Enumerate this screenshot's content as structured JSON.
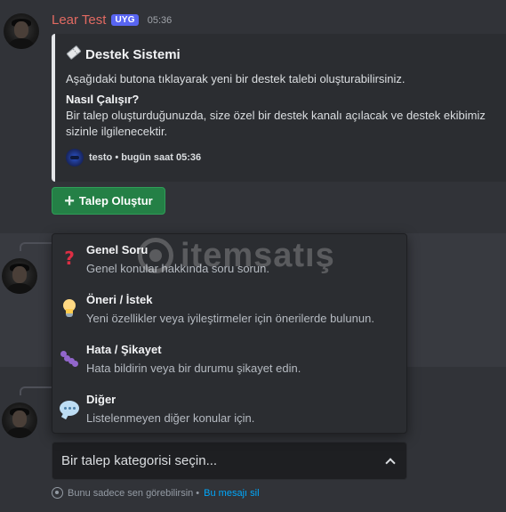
{
  "message": {
    "username": "Lear Test",
    "app_badge": "UYG",
    "timestamp": "05:36",
    "embed": {
      "title_icon": "ticket-icon",
      "title": "Destek Sistemi",
      "description": "Aşağıdaki butona tıklayarak yeni bir destek talebi oluşturabilirsiniz.",
      "field_name": "Nasıl Çalışır?",
      "field_value": "Bir talep oluşturduğunuzda, size özel bir destek kanalı açılacak ve destek ekibimiz sizinle ilgilenecektir.",
      "footer_text": "testo • bugün saat 05:36"
    },
    "create_button_label": "Talep Oluştur"
  },
  "dropdown": {
    "options": [
      {
        "icon": "question-mark-icon",
        "label": "Genel Soru",
        "description": "Genel konular hakkında soru sorun."
      },
      {
        "icon": "light-bulb-icon",
        "label": "Öneri / İstek",
        "description": "Yeni özellikler veya iyileştirmeler için önerilerde bulunun."
      },
      {
        "icon": "bug-icon",
        "label": "Hata / Şikayet",
        "description": "Hata bildirin veya bir durumu şikayet edin."
      },
      {
        "icon": "speech-bubble-icon",
        "label": "Diğer",
        "description": "Listelenmeyen diğer konular için."
      }
    ]
  },
  "select": {
    "placeholder": "Bir talep kategorisi seçin..."
  },
  "ephemeral": {
    "text": "Bunu sadece sen görebilirsin •",
    "dismiss_link": "Bu mesajı sil"
  },
  "watermark": {
    "text": "itemsatış"
  },
  "colors": {
    "background": "#313338",
    "username": "#e26a62",
    "badge": "#5865f2",
    "button_green": "#248046",
    "link": "#00a8fc"
  }
}
